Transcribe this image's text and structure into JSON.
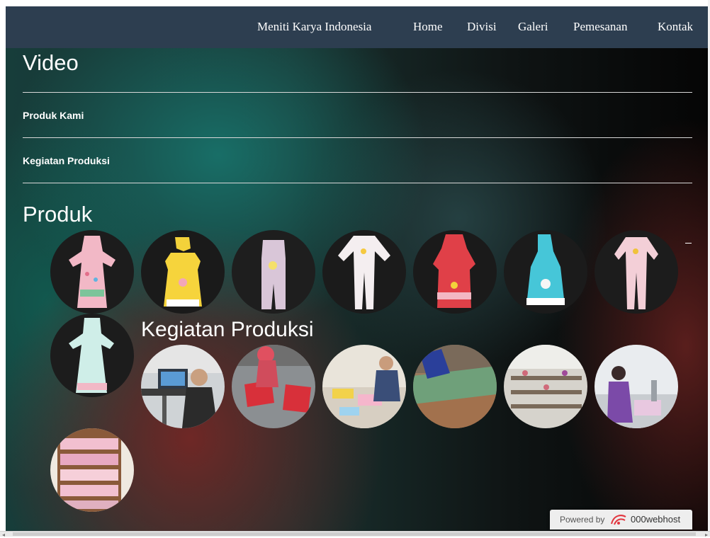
{
  "navbar": {
    "brand": "Meniti Karya Indonesia",
    "links": [
      "Home",
      "Divisi",
      "Galeri",
      "Pemesanan",
      "Kontak"
    ],
    "background": "#2d3e50"
  },
  "video": {
    "title": "Video",
    "links": [
      "Produk Kami",
      "Kegiatan Produksi"
    ]
  },
  "produk": {
    "title": "Produk",
    "items": [
      "pink-dress-photo",
      "yellow-dress-hood-photo",
      "lavender-romper-photo",
      "white-pajama-photo",
      "red-hooded-dress-photo",
      "blue-hooded-dress-photo",
      "pink-pajama-photo",
      "mint-dress-photo"
    ]
  },
  "kegiatan": {
    "title": "Kegiatan Produksi",
    "items": [
      "computer-workstation-photo",
      "fabric-cutting-photo",
      "sewing-table-photo",
      "pattern-layout-photo",
      "factory-floor-photo",
      "sewing-worker-photo",
      "garment-shelves-photo"
    ]
  },
  "footer": {
    "powered_label": "Powered by",
    "brand": "000webhost"
  }
}
